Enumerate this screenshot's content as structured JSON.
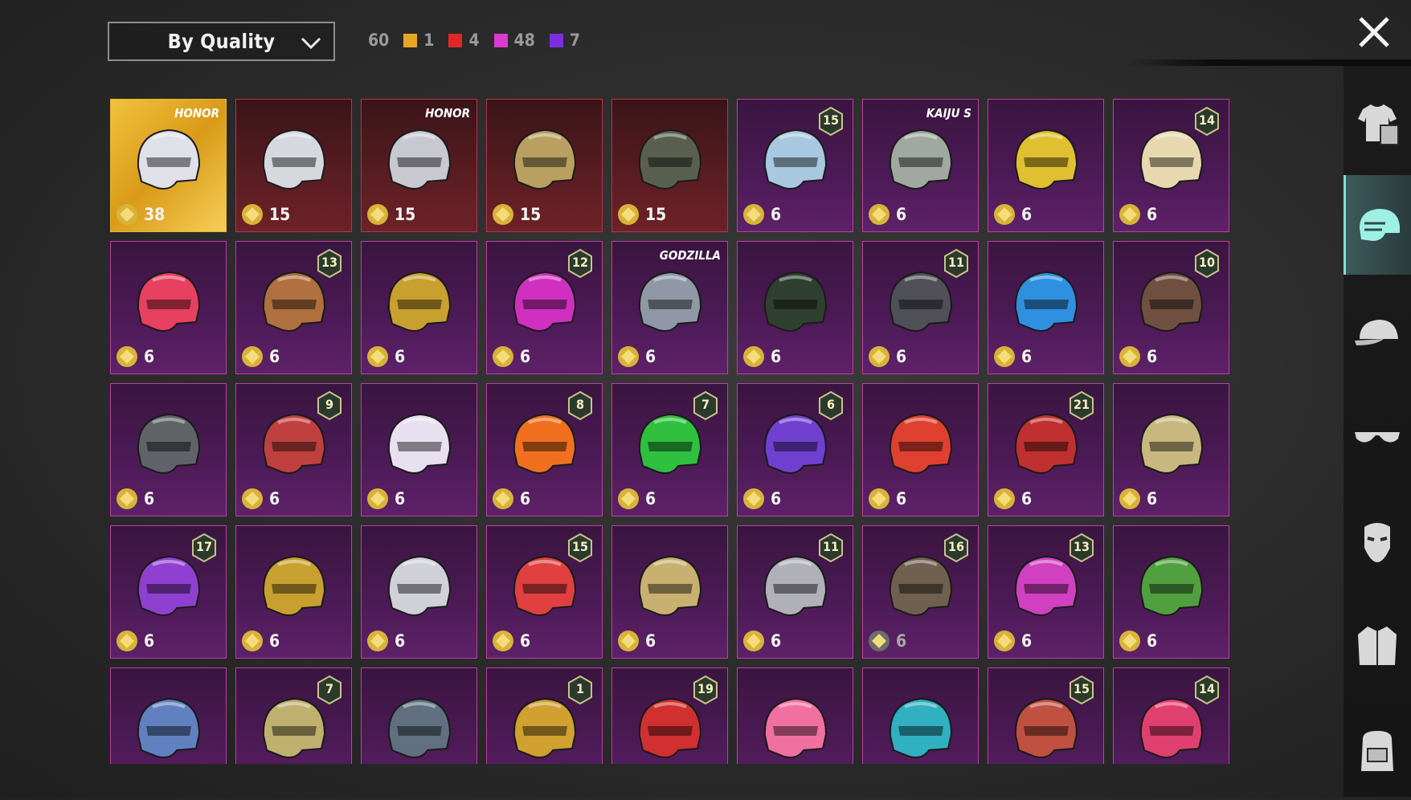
{
  "sort": {
    "label": "By Quality"
  },
  "summary": {
    "total": "60",
    "tiers": [
      {
        "color": "#e8a722",
        "count": "1"
      },
      {
        "color": "#e22727",
        "count": "4"
      },
      {
        "color": "#d93ad0",
        "count": "48"
      },
      {
        "color": "#7b2fe0",
        "count": "7"
      }
    ]
  },
  "rows": [
    [
      {
        "price": "38",
        "quality": "gold",
        "tag": "HONOR",
        "helm": "#e0e0e8"
      },
      {
        "price": "15",
        "quality": "red",
        "helm": "#d5d8dd"
      },
      {
        "price": "15",
        "quality": "red",
        "tag": "HONOR",
        "helm": "#c8c8d0"
      },
      {
        "price": "15",
        "quality": "red",
        "helm": "#b9a060"
      },
      {
        "price": "15",
        "quality": "red",
        "helm": "#5a6050"
      },
      {
        "price": "6",
        "quality": "purple",
        "badge": "15",
        "helm": "#a8c8e0"
      },
      {
        "price": "6",
        "quality": "purple",
        "tag": "KAIJU S",
        "helm": "#a0a8a0"
      },
      {
        "price": "6",
        "quality": "purple",
        "helm": "#e0c030"
      },
      {
        "price": "6",
        "quality": "purple",
        "badge": "14",
        "helm": "#e8d8b0"
      }
    ],
    [
      {
        "price": "6",
        "quality": "purple",
        "helm": "#e84060"
      },
      {
        "price": "6",
        "quality": "purple",
        "badge": "13",
        "helm": "#b07040"
      },
      {
        "price": "6",
        "quality": "purple",
        "helm": "#c8a030"
      },
      {
        "price": "6",
        "quality": "purple",
        "badge": "12",
        "helm": "#d030c0"
      },
      {
        "price": "6",
        "quality": "purple",
        "tag": "GODZILLA",
        "helm": "#9098a8"
      },
      {
        "price": "6",
        "quality": "purple",
        "helm": "#304030"
      },
      {
        "price": "6",
        "quality": "purple",
        "badge": "11",
        "helm": "#505058"
      },
      {
        "price": "6",
        "quality": "purple",
        "helm": "#3090e0"
      },
      {
        "price": "6",
        "quality": "purple",
        "badge": "10",
        "helm": "#705040"
      }
    ],
    [
      {
        "price": "6",
        "quality": "purple",
        "helm": "#606468"
      },
      {
        "price": "6",
        "quality": "purple",
        "badge": "9",
        "helm": "#c04040"
      },
      {
        "price": "6",
        "quality": "purple",
        "helm": "#e8e0f0"
      },
      {
        "price": "6",
        "quality": "purple",
        "badge": "8",
        "helm": "#f07020"
      },
      {
        "price": "6",
        "quality": "purple",
        "badge": "7",
        "helm": "#30c040"
      },
      {
        "price": "6",
        "quality": "purple",
        "badge": "6",
        "helm": "#7040d0"
      },
      {
        "price": "6",
        "quality": "purple",
        "helm": "#e04030"
      },
      {
        "price": "6",
        "quality": "purple",
        "badge": "21",
        "helm": "#c03030"
      },
      {
        "price": "6",
        "quality": "purple",
        "helm": "#c8b880"
      }
    ],
    [
      {
        "price": "6",
        "quality": "purple",
        "badge": "17",
        "helm": "#9040d0"
      },
      {
        "price": "6",
        "quality": "purple",
        "helm": "#c8a030"
      },
      {
        "price": "6",
        "quality": "purple",
        "helm": "#d0d0d8"
      },
      {
        "price": "6",
        "quality": "purple",
        "badge": "15",
        "helm": "#e04040"
      },
      {
        "price": "6",
        "quality": "purple",
        "helm": "#c8b070"
      },
      {
        "price": "6",
        "quality": "purple",
        "badge": "11",
        "helm": "#b0b0b8"
      },
      {
        "price": "6",
        "quality": "dim",
        "badge": "16",
        "helm": "#706050"
      },
      {
        "price": "6",
        "quality": "purple",
        "badge": "13",
        "helm": "#d040c0"
      },
      {
        "price": "6",
        "quality": "purple",
        "helm": "#50a040"
      }
    ],
    [
      {
        "price": "",
        "quality": "purple",
        "helm": "#6080c0"
      },
      {
        "price": "",
        "quality": "purple",
        "badge": "7",
        "helm": "#c0b070"
      },
      {
        "price": "",
        "quality": "purple",
        "helm": "#607080"
      },
      {
        "price": "",
        "quality": "purple",
        "badge": "1",
        "helm": "#d0a030"
      },
      {
        "price": "",
        "quality": "purple",
        "badge": "19",
        "helm": "#d03030"
      },
      {
        "price": "",
        "quality": "purple",
        "helm": "#f070a0"
      },
      {
        "price": "",
        "quality": "purple",
        "helm": "#30b0c0"
      },
      {
        "price": "",
        "quality": "purple",
        "badge": "15",
        "helm": "#c05040"
      },
      {
        "price": "",
        "quality": "purple",
        "badge": "14",
        "helm": "#e04070"
      }
    ]
  ],
  "sidebar": [
    "outfit-icon",
    "helmet-icon",
    "cap-icon",
    "glasses-icon",
    "mask-icon",
    "jacket-icon",
    "backpack-icon"
  ]
}
